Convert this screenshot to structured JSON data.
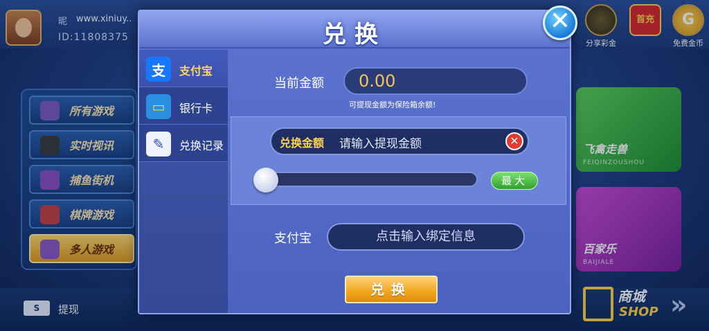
{
  "profile": {
    "nickname_icon": "昵",
    "nickname": "www.xiniuy..",
    "id": "ID:11808375"
  },
  "top_right": [
    {
      "label": "分享彩金",
      "icon": "treasure-chest-icon"
    },
    {
      "label": "",
      "icon": "first-charge-icon",
      "text": "首充"
    },
    {
      "label": "免费金币",
      "icon": "gold-coin-icon",
      "text": "G"
    }
  ],
  "categories": [
    {
      "label": "所有游戏",
      "active": false
    },
    {
      "label": "实时视讯",
      "active": false
    },
    {
      "label": "捕鱼街机",
      "active": false
    },
    {
      "label": "棋牌游戏",
      "active": false
    },
    {
      "label": "多人游戏",
      "active": true
    }
  ],
  "games": [
    {
      "name": "飞禽走兽",
      "sub": "FEIQINZOUSHOU",
      "color": "#3dbb3d"
    },
    {
      "name": "百家乐",
      "sub": "BAIJIALE",
      "color": "#b02fbf"
    }
  ],
  "bottom": {
    "withdraw_icon": "S",
    "withdraw_label": "提现",
    "shop_label": "商城",
    "shop_en": "SHOP",
    "arrow": "»"
  },
  "dialog": {
    "title": "兑换",
    "close_symbol": "✕",
    "tabs": [
      {
        "label": "支付宝",
        "icon": "alipay-icon",
        "glyph": "支",
        "active": true
      },
      {
        "label": "银行卡",
        "icon": "bank-card-icon",
        "glyph": "▭",
        "active": false
      },
      {
        "label": "兑换记录",
        "icon": "record-icon",
        "glyph": "✎",
        "active": false
      }
    ],
    "current_amount_label": "当前金额",
    "current_amount_value": "0.00",
    "hint": "可提现金额为保险箱余额!",
    "exchange_label": "兑换金额",
    "exchange_placeholder": "请输入提现金额",
    "clear_symbol": "✕",
    "slider_fraction": 0,
    "max_label": "最大",
    "alipay_label": "支付宝",
    "bind_placeholder": "点击输入绑定信息",
    "submit_label": "兑换"
  }
}
